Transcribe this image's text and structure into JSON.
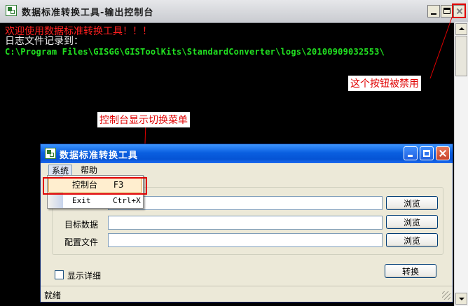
{
  "console_window": {
    "title": "数据标准转换工具-输出控制台",
    "lines": {
      "welcome": "欢迎使用数据标准转换工具！！！",
      "log_label": "日志文件记录到：",
      "log_path": "C:\\Program Files\\GISGG\\GISToolKits\\StandardConverter\\logs\\20100909032553\\"
    }
  },
  "annotations": {
    "disabled_button": "这个按钮被禁用",
    "menu_toggle": "控制台显示切换菜单"
  },
  "tool_window": {
    "title": "数据标准转换工具",
    "menubar": {
      "system": "系统",
      "help": "帮助"
    },
    "fields": {
      "target_label": "目标数据",
      "config_label": "配置文件",
      "browse_label": "浏览"
    },
    "show_detail_label": "显示详细",
    "convert_label": "转换",
    "status": "就绪"
  },
  "dropdown": {
    "items": [
      {
        "label": "控制台",
        "shortcut": "F3",
        "highlighted": true
      },
      {
        "label": "Exit",
        "shortcut": "Ctrl+X",
        "highlighted": false
      }
    ]
  },
  "colors": {
    "annotation": "#e00000",
    "console_red": "#ff2020",
    "console_green": "#21e021",
    "xp_title_blue": "#0553d4"
  },
  "icons": {
    "app": "converter-app-icon",
    "minimize": "minimize-icon",
    "maximize": "maximize-icon",
    "close": "close-icon"
  }
}
